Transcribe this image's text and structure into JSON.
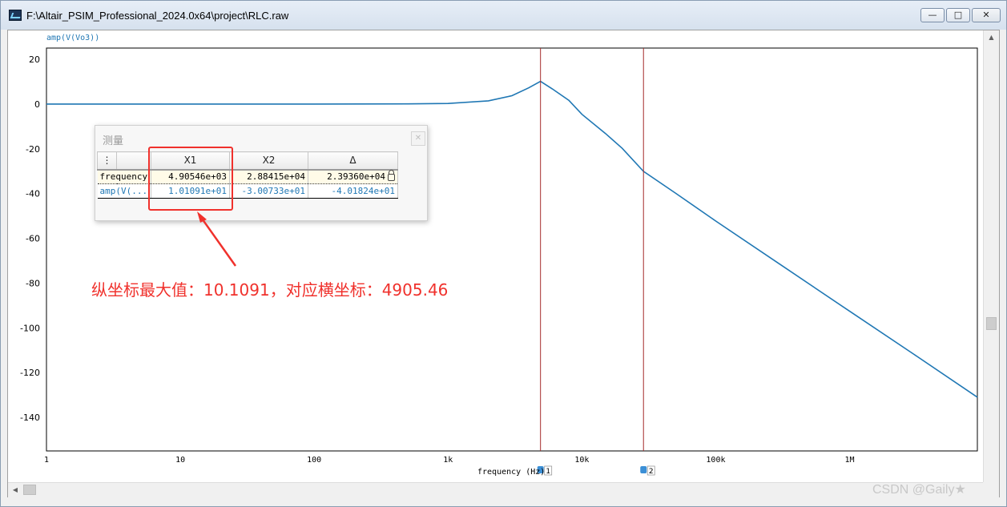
{
  "window": {
    "title": "F:\\Altair_PSIM_Professional_2024.0x64\\project\\RLC.raw",
    "minimize": "—",
    "maximize": "□",
    "close": "✕"
  },
  "icons": {
    "app": "app-icon",
    "minimize": "minimize-icon",
    "maximize": "maximize-icon",
    "close": "close-icon",
    "lock": "lock-icon",
    "menu": "vertical-dots-icon"
  },
  "colors": {
    "trace": "#1f77b4",
    "cursor": "#a52a2a",
    "annotation": "#f0312c"
  },
  "chart_data": {
    "type": "line",
    "trace_label": "amp(V(Vo3))",
    "xlabel": "frequency (Hz)",
    "x_scale": "log",
    "xlim": [
      1,
      9000000
    ],
    "ylim": [
      -155,
      25
    ],
    "y_ticks": [
      20,
      0,
      -20,
      -40,
      -60,
      -80,
      -100,
      -120,
      -140
    ],
    "x_ticks": [
      {
        "value": 1,
        "label": "1"
      },
      {
        "value": 10,
        "label": "10"
      },
      {
        "value": 100,
        "label": "100"
      },
      {
        "value": 1000,
        "label": "1k"
      },
      {
        "value": 10000,
        "label": "10k"
      },
      {
        "value": 100000,
        "label": "100k"
      },
      {
        "value": 1000000,
        "label": "1M"
      }
    ],
    "grid": true,
    "series": [
      {
        "x": [
          1,
          10,
          100,
          500,
          1000,
          2000,
          3000,
          4000,
          4905.46,
          6000,
          8000,
          10000,
          15000,
          20000,
          28841.5,
          50000,
          100000,
          300000,
          1000000,
          3000000,
          9000000
        ],
        "y": [
          0,
          0,
          0,
          0.05,
          0.25,
          1.4,
          3.7,
          7.2,
          10.1091,
          6.8,
          1.6,
          -4.6,
          -13.2,
          -19.8,
          -30.0733,
          -39.8,
          -52.3,
          -71.5,
          -92.6,
          -111.7,
          -131.0
        ]
      }
    ],
    "cursors": [
      {
        "id": "1",
        "x": 4905.46
      },
      {
        "id": "2",
        "x": 28841.5
      }
    ]
  },
  "measure": {
    "title": "测量",
    "columns": [
      "X1",
      "X2",
      "Δ"
    ],
    "rows": [
      {
        "label": "frequency",
        "x1": "4.90546e+03",
        "x2": "2.88415e+04",
        "delta": "2.39360e+04"
      },
      {
        "label": "amp(V(...",
        "x1": "1.01091e+01",
        "x2": "-3.00733e+01",
        "delta": "-4.01824e+01"
      }
    ]
  },
  "annotation": {
    "text": "纵坐标最大值：10.1091，对应横坐标：4905.46"
  },
  "watermark": "CSDN @Gaily★"
}
